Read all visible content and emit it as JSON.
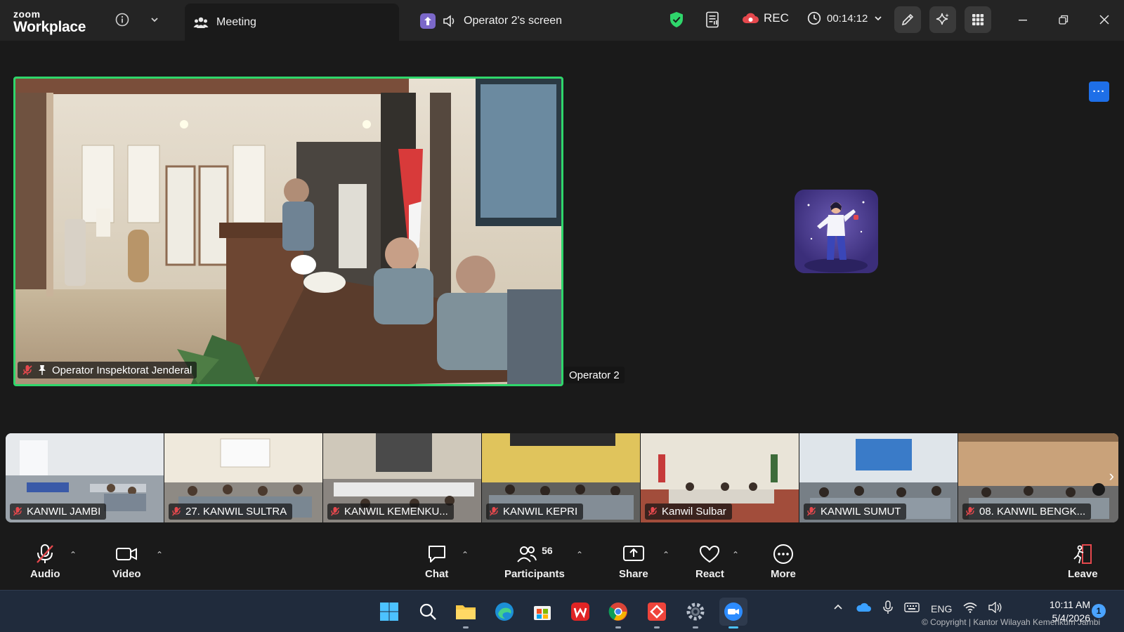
{
  "app": {
    "brand_top": "zoom",
    "brand_bottom": "Workplace"
  },
  "tabs": {
    "meeting": "Meeting",
    "share": "Operator 2's screen"
  },
  "status": {
    "rec": "REC",
    "timer": "00:14:12"
  },
  "main": {
    "speaker_name": "Operator Inspektorat Jenderal",
    "second_name": "Operator 2"
  },
  "gallery": [
    {
      "name": "KANWIL JAMBI"
    },
    {
      "name": "27. KANWIL SULTRA"
    },
    {
      "name": "KANWIL KEMENKU..."
    },
    {
      "name": "KANWIL KEPRI"
    },
    {
      "name": "Kanwil Sulbar"
    },
    {
      "name": "KANWIL SUMUT"
    },
    {
      "name": "08. KANWIL BENGK..."
    }
  ],
  "controls": {
    "audio": "Audio",
    "video": "Video",
    "chat": "Chat",
    "participants": "Participants",
    "participants_count": "56",
    "share": "Share",
    "react": "React",
    "more": "More",
    "leave": "Leave"
  },
  "taskbar": {
    "language": "ENG",
    "time": "10:11 AM",
    "date": "5/4/2026",
    "notifications": "1",
    "watermark": "© Copyright | Kantor Wilayah Kemenkum Jambi"
  },
  "colors": {
    "active_speaker_border": "#2fd66b",
    "accent_blue": "#1e6fe8",
    "rec_red": "#e5484d",
    "leave_red": "#e5484d",
    "security_green": "#2fd66b"
  }
}
